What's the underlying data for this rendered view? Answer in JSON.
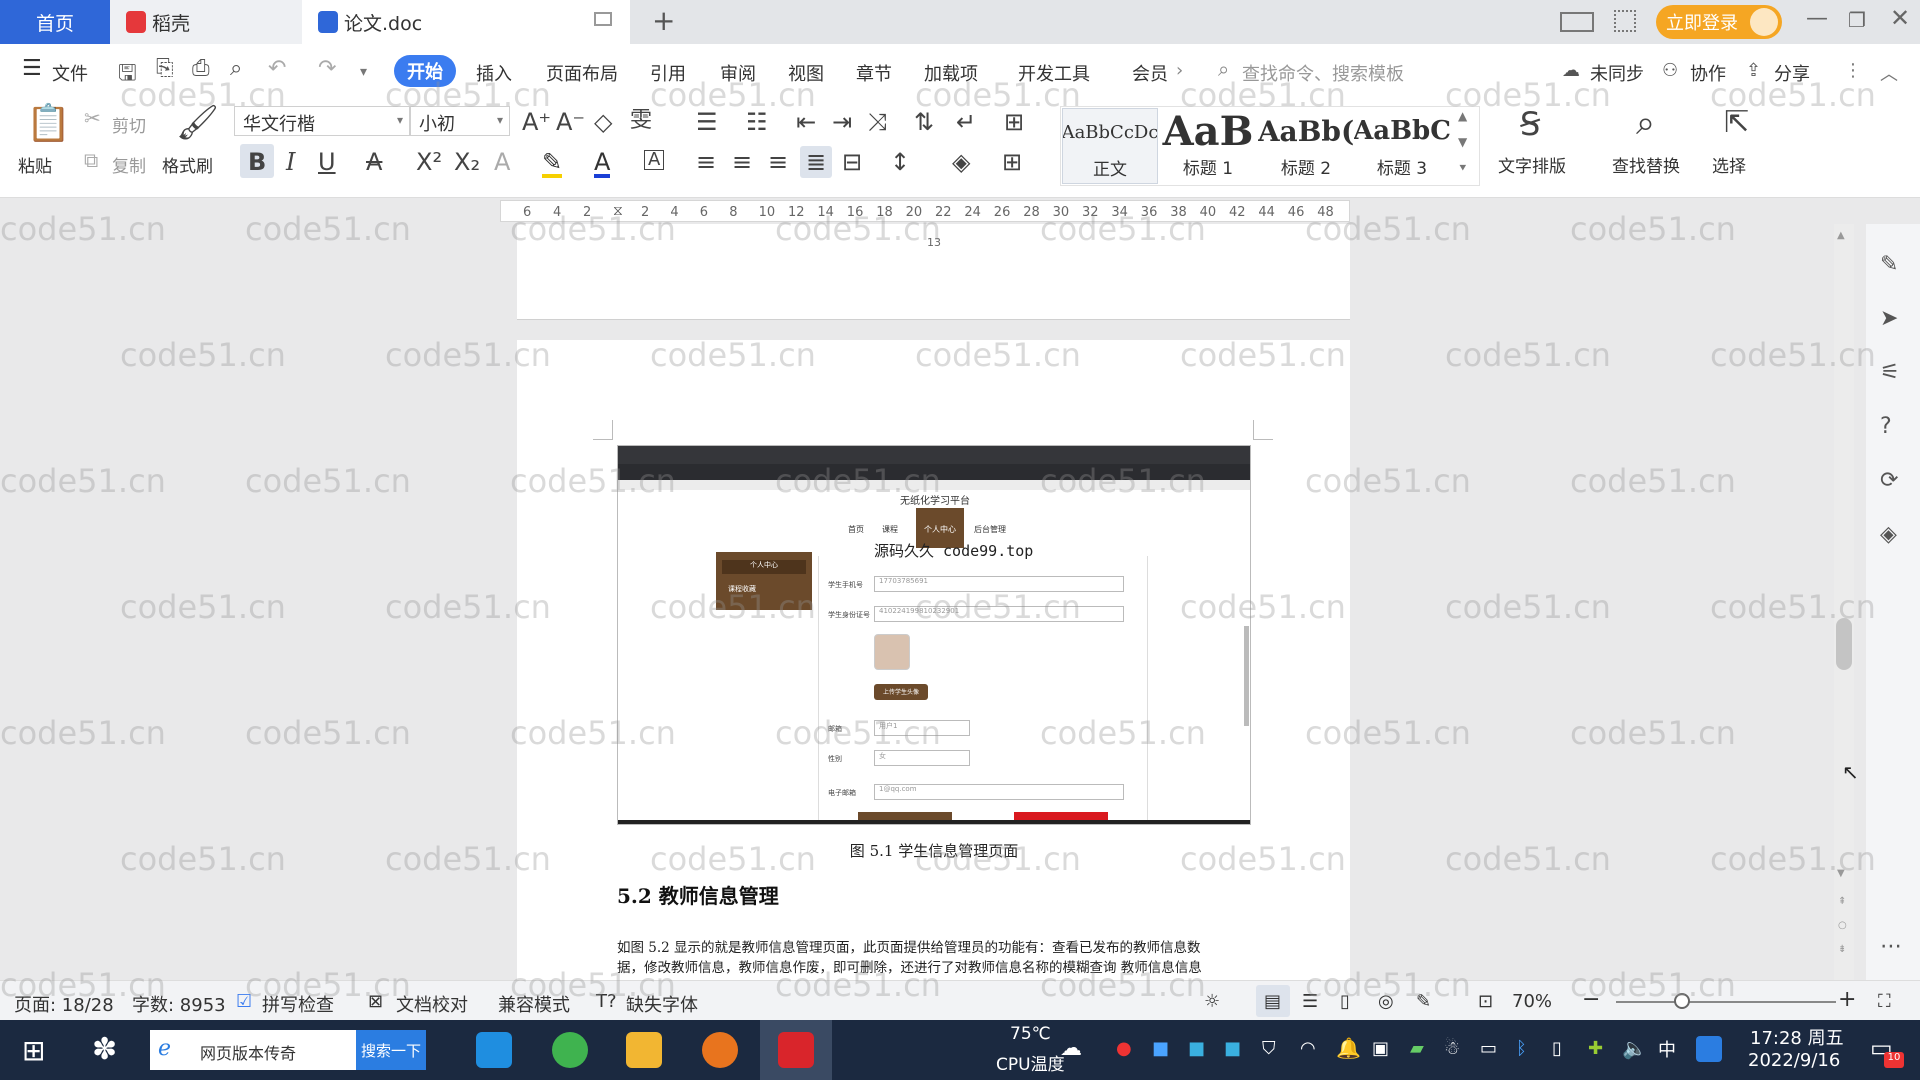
{
  "titlebar": {
    "tabs": [
      {
        "label": "首页"
      },
      {
        "label": "稻壳"
      },
      {
        "label": "论文.doc"
      }
    ],
    "new_tab": "+",
    "login_label": "立即登录"
  },
  "menubar": {
    "file": "文件",
    "items": [
      "开始",
      "插入",
      "页面布局",
      "引用",
      "审阅",
      "视图",
      "章节",
      "加载项",
      "开发工具",
      "会员"
    ],
    "search_placeholder": "查找命令、搜索模板",
    "sync": "未同步",
    "collab": "协作",
    "share": "分享"
  },
  "toolbar": {
    "paste": "粘贴",
    "cut": "剪切",
    "copy": "复制",
    "format_painter": "格式刷",
    "font_name": "华文行楷",
    "font_size": "小初",
    "styles": [
      {
        "preview": "AaBbCcDc",
        "label": "正文"
      },
      {
        "preview": "AaB",
        "label": "标题 1"
      },
      {
        "preview": "AaBb(",
        "label": "标题 2"
      },
      {
        "preview": "AaBbC",
        "label": "标题 3"
      }
    ],
    "text_layout": "文字排版",
    "find_replace": "查找替换",
    "select": "选择"
  },
  "ruler": {
    "left_numbers": [
      "6",
      "4",
      "2"
    ],
    "numbers": [
      "2",
      "4",
      "6",
      "8",
      "10",
      "12",
      "14",
      "16",
      "18",
      "20",
      "22",
      "24",
      "26",
      "28",
      "30",
      "32",
      "34",
      "36",
      "38",
      "40",
      "42",
      "44",
      "46",
      "48"
    ]
  },
  "document": {
    "page_number": "13",
    "figure_caption": "图 5.1  学生信息管理页面",
    "section_heading": "5.2  教师信息管理",
    "paragraph_line1": "如图 5.2 显示的就是教师信息管理页面，此页面提供给管理员的功能有：查看已发布的教师信息数",
    "paragraph_line2": "据，修改教师信息，教师信息作废，即可删除，还进行了对教师信息名称的模糊查询 教师信息信息",
    "embedded": {
      "site_title": "无纸化学习平台",
      "nav": [
        "首页",
        "课程",
        "个人中心",
        "后台管理"
      ],
      "overlay": "源码久久 code99.top",
      "side_menu": [
        "个人中心",
        "课程收藏"
      ],
      "fields": [
        {
          "label": "学生手机号",
          "value": "17703785691"
        },
        {
          "label": "学生身份证号",
          "value": "410224199810232901"
        },
        {
          "label": "邮箱",
          "value": "用户1"
        },
        {
          "label": "性别",
          "value": "女"
        },
        {
          "label": "电子邮箱",
          "value": "1@qq.com"
        }
      ],
      "upload_button": "上传学生头像"
    }
  },
  "watermark": "code51.cn",
  "statusbar": {
    "page": "页面: 18/28",
    "words": "字数: 8953",
    "spellcheck": "拼写检查",
    "proofread": "文档校对",
    "compat": "兼容模式",
    "missing_font": "缺失字体",
    "zoom": "70%"
  },
  "taskbar": {
    "search_box": "网页版本传奇",
    "search_button": "搜索一下",
    "temp": "75℃",
    "temp_label": "CPU温度",
    "ime": "中",
    "time": "17:28 周五",
    "date": "2022/9/16",
    "notif_count": "10"
  }
}
